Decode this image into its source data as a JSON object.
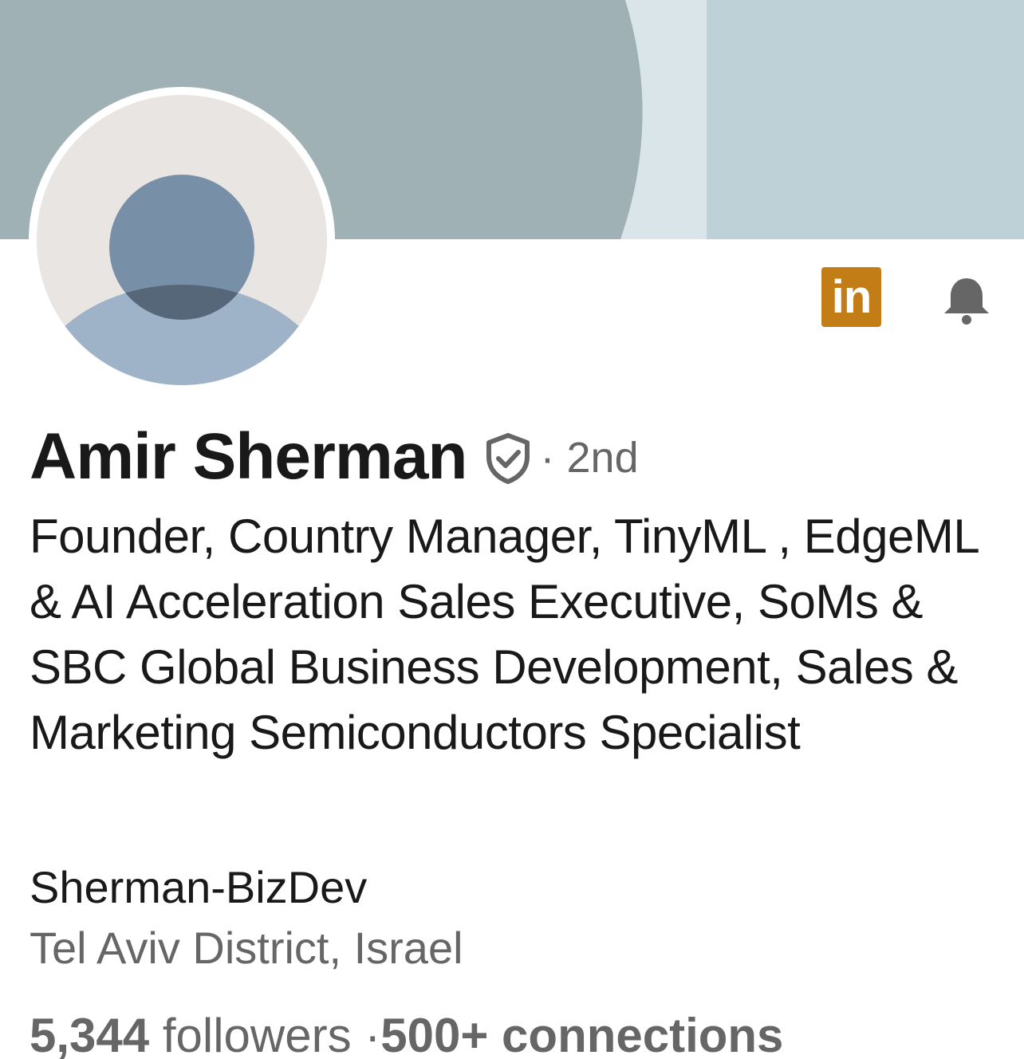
{
  "profile": {
    "name": "Amir Sherman",
    "degree": "· 2nd",
    "headline": "Founder, Country Manager, TinyML , EdgeML & AI Acceleration Sales Executive, SoMs & SBC Global Business Development, Sales & Marketing Semiconductors Specialist",
    "company": "Sherman-BizDev",
    "location": "Tel Aviv District, Israel",
    "followers_count": "5,344",
    "followers_label": " followers ·",
    "connections_count": "500+ connections"
  },
  "badges": {
    "premium_label": "in"
  },
  "icons": {
    "verified": "shield-check-icon",
    "notifications": "bell-icon",
    "premium": "linkedin-premium-icon",
    "avatar": "default-avatar-icon"
  },
  "colors": {
    "premium_gold": "#c37d16",
    "text_primary": "#191919",
    "text_secondary": "#666666",
    "banner_dark": "#9fb1b5",
    "banner_light": "#bdd1d6",
    "banner_stripe": "#d9e5e8"
  }
}
